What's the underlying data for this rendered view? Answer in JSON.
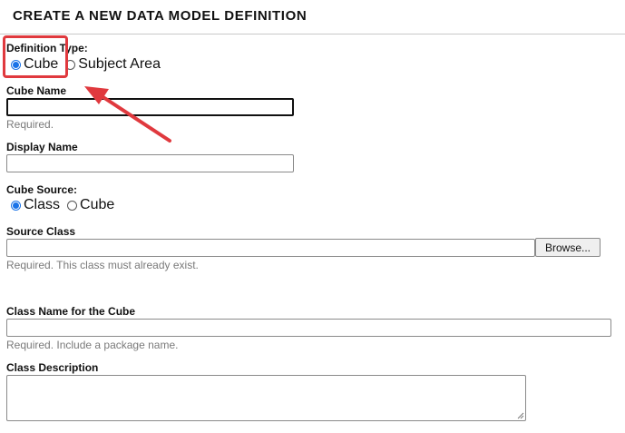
{
  "page": {
    "title": "CREATE A NEW DATA MODEL DEFINITION"
  },
  "definition_type": {
    "label": "Definition Type:",
    "options": [
      "Cube",
      "Subject Area"
    ],
    "selected": "Cube"
  },
  "cube_name": {
    "label": "Cube Name",
    "value": "",
    "help": "Required."
  },
  "display_name": {
    "label": "Display Name",
    "value": ""
  },
  "cube_source": {
    "label": "Cube Source:",
    "options": [
      "Class",
      "Cube"
    ],
    "selected": "Class"
  },
  "source_class": {
    "label": "Source Class",
    "value": "",
    "browse_label": "Browse...",
    "help": "Required. This class must already exist."
  },
  "class_name": {
    "label": "Class Name for the Cube",
    "value": "",
    "help": "Required. Include a package name."
  },
  "class_description": {
    "label": "Class Description",
    "value": ""
  },
  "annotation": {
    "highlight_color": "#e0393e"
  }
}
